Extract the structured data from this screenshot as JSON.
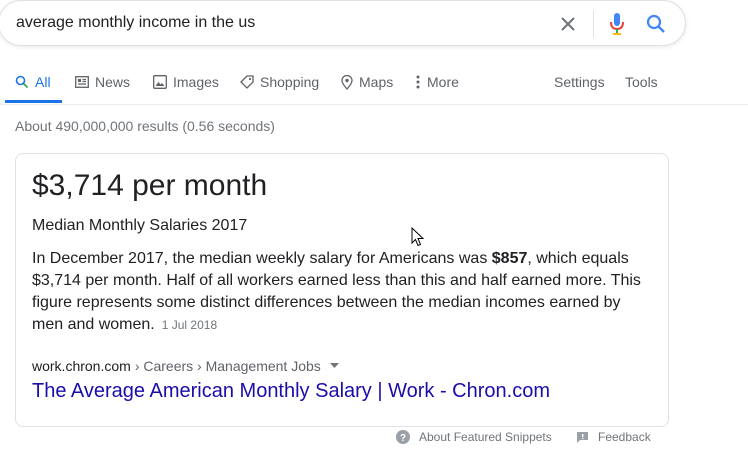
{
  "search": {
    "query": "average monthly income in the us"
  },
  "tabs": [
    {
      "label": "All"
    },
    {
      "label": "News"
    },
    {
      "label": "Images"
    },
    {
      "label": "Shopping"
    },
    {
      "label": "Maps"
    },
    {
      "label": "More"
    }
  ],
  "tools": {
    "settings": "Settings",
    "tools": "Tools"
  },
  "stats": "About 490,000,000 results (0.56 seconds)",
  "snippet": {
    "answer": "$3,714 per month",
    "subtitle": "Median Monthly Salaries 2017",
    "text_before": "In December 2017, the median weekly salary for Americans was ",
    "bold_value": "$857",
    "text_after": ", which equals $3,714 per month. Half of all workers earned less than this and half earned more. This figure represents some distinct differences between the median incomes earned by men and women.",
    "date": "1 Jul 2018",
    "source_domain": "work.chron.com",
    "source_path": "› Careers › Management Jobs",
    "link_title": "The Average American Monthly Salary | Work - Chron.com"
  },
  "footer": {
    "about": "About Featured Snippets",
    "feedback": "Feedback"
  },
  "colors": {
    "accent": "#1a73e8",
    "link": "#1a0dab",
    "muted": "#70757a"
  },
  "icons": [
    "clear-icon",
    "mic-icon",
    "search-icon",
    "news-icon",
    "images-icon",
    "shopping-tag-icon",
    "maps-pin-icon",
    "more-dots-icon",
    "help-icon",
    "feedback-icon"
  ]
}
